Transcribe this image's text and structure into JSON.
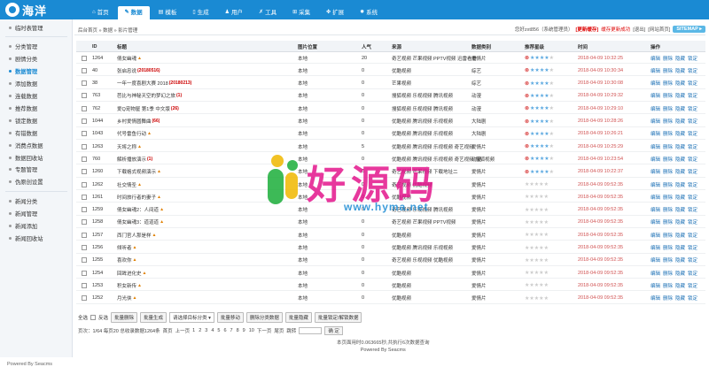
{
  "logo": {
    "text": "海洋"
  },
  "nav": [
    {
      "label": "首页",
      "icon": "home-icon",
      "glyph": "⌂",
      "active": false
    },
    {
      "label": "数据",
      "icon": "edit-icon",
      "glyph": "✎",
      "active": true
    },
    {
      "label": "模板",
      "icon": "template-icon",
      "glyph": "▤",
      "active": false
    },
    {
      "label": "生成",
      "icon": "file-icon",
      "glyph": "▯",
      "active": false
    },
    {
      "label": "用户",
      "icon": "user-icon",
      "glyph": "♟",
      "active": false
    },
    {
      "label": "工具",
      "icon": "tool-icon",
      "glyph": "✗",
      "active": false
    },
    {
      "label": "采集",
      "icon": "collect-icon",
      "glyph": "⊞",
      "active": false
    },
    {
      "label": "扩展",
      "icon": "extend-icon",
      "glyph": "✤",
      "active": false
    },
    {
      "label": "系统",
      "icon": "gear-icon",
      "glyph": "✹",
      "active": false
    }
  ],
  "sidebar": {
    "groups": [
      [
        "临时表管理"
      ],
      [
        "分类管理",
        "剧情分类",
        "数据管理",
        "添加数据",
        "连载数据",
        "推荐数据",
        "锁定数据",
        "有错数据",
        "消费点数据",
        "数据回收站",
        "专题管理",
        "伪原创设置"
      ],
      [
        "新闻分类",
        "新闻管理",
        "新闻添加",
        "新闻回收站"
      ]
    ],
    "active": "数据管理",
    "powered": "Powered By Seacms"
  },
  "crumb": "后台首页 » 数据 » 影片管理",
  "topright": {
    "user": "您好zxt856（系统管理员）",
    "update": "[更新缓存]",
    "update_ok": "缓存更新成功",
    "logout": "[退出]",
    "home": "[网站首页]",
    "sitemap": "SITEMAP ▸"
  },
  "headers": {
    "id": "ID",
    "title": "标题",
    "pos": "图片位置",
    "pop": "人气",
    "src": "来源",
    "cat": "数据类别",
    "stars": "推荐星级",
    "time": "时间",
    "op": "操作"
  },
  "ops": [
    "编辑",
    "删除",
    "隐藏",
    "锁定"
  ],
  "rows": [
    {
      "id": "1264",
      "title": "倩女幽魂",
      "badge": "",
      "hot": true,
      "pos": "本地",
      "pop": "20",
      "src": "奇艺视频 芒果视频 PPTV视频 迅雷看看",
      "cat": "爱情片",
      "stars": 4,
      "time": "2018-04-09 10:32:25"
    },
    {
      "id": "40",
      "title": "张启忠说",
      "badge": "(20180516)",
      "hot": false,
      "pos": "本地",
      "pop": "0",
      "src": "优酷视频",
      "cat": "综艺",
      "stars": 4,
      "time": "2018-04-09 10:30:34"
    },
    {
      "id": "38",
      "title": "一年一度喜剧大赛 2018",
      "badge": "(20180213)",
      "hot": false,
      "pos": "本地",
      "pop": "0",
      "src": "芒果视频",
      "cat": "综艺",
      "stars": 4,
      "time": "2018-04-09 10:30:08"
    },
    {
      "id": "763",
      "title": "芭比与神秘天空的梦幻之旅",
      "badge": "(1)",
      "hot": false,
      "pos": "本地",
      "pop": "0",
      "src": "搜狐视频 乐视视频 腾讯视频",
      "cat": "动漫",
      "stars": 4,
      "time": "2018-04-09 10:29:32"
    },
    {
      "id": "762",
      "title": "爱Q宠物屋 第1季 中文版",
      "badge": "(26)",
      "hot": false,
      "pos": "本地",
      "pop": "0",
      "src": "搜狐视频 乐视视频 腾讯视频",
      "cat": "动漫",
      "stars": 4,
      "time": "2018-04-09 10:29:10"
    },
    {
      "id": "1044",
      "title": "乡村爱情圆舞曲",
      "badge": "(66)",
      "hot": false,
      "pos": "本地",
      "pop": "0",
      "src": "优酷视频 腾讯视频 乐视视频",
      "cat": "大陆剧",
      "stars": 4,
      "time": "2018-04-09 10:28:26"
    },
    {
      "id": "1043",
      "title": "代号雷鱼行动",
      "badge": "",
      "hot": true,
      "pos": "本地",
      "pop": "0",
      "src": "优酷视频 腾讯视频 乐视视频",
      "cat": "大陆剧",
      "stars": 4,
      "time": "2018-04-09 10:26:21"
    },
    {
      "id": "1263",
      "title": "天将之称",
      "badge": "",
      "hot": true,
      "pos": "本地",
      "pop": "5",
      "src": "优酷视频 腾讯视频 乐视视频 奇艺视频",
      "cat": "爱情片",
      "stars": 4,
      "time": "2018-04-09 10:25:29"
    },
    {
      "id": "760",
      "title": "解析播放演示",
      "badge": "(1)",
      "hot": false,
      "pos": "本地",
      "pop": "0",
      "src": "优酷视频 腾讯视频 乐视视频 奇艺视频 搜狐视频",
      "cat": "动漫",
      "stars": 4,
      "time": "2018-04-09 10:23:54"
    },
    {
      "id": "1260",
      "title": "下载格式视频演示",
      "badge": "",
      "hot": true,
      "pos": "本地",
      "pop": "0",
      "src": "奇艺视频 芒果视频 下载地址二",
      "cat": "爱情片",
      "stars": 4,
      "time": "2018-04-09 10:22:37"
    },
    {
      "id": "1262",
      "title": "社交情圣",
      "badge": "",
      "hot": true,
      "pos": "本地",
      "pop": "0",
      "src": "奇艺视频 优酷视频",
      "cat": "爱情片",
      "stars": 0,
      "time": "2018-04-09 09:52:35"
    },
    {
      "id": "1261",
      "title": "时间旅行者的妻子",
      "badge": "",
      "hot": true,
      "pos": "本地",
      "pop": "0",
      "src": "优酷视频",
      "cat": "爱情片",
      "stars": 0,
      "time": "2018-04-09 09:52:35"
    },
    {
      "id": "1259",
      "title": "倩女幽魂2：人间道",
      "badge": "",
      "hot": true,
      "pos": "本地",
      "pop": "0",
      "src": "奇艺视频 乐视视频 腾讯视频",
      "cat": "爱情片",
      "stars": 0,
      "time": "2018-04-09 09:52:35"
    },
    {
      "id": "1258",
      "title": "倩女幽魂3：道道道",
      "badge": "",
      "hot": true,
      "pos": "本地",
      "pop": "0",
      "src": "奇艺视频 芒果视频 PPTV视频",
      "cat": "爱情片",
      "stars": 0,
      "time": "2018-04-09 09:52:35"
    },
    {
      "id": "1257",
      "title": "西门官人那是样",
      "badge": "",
      "hot": true,
      "pos": "本地",
      "pop": "0",
      "src": "优酷视频",
      "cat": "爱情片",
      "stars": 0,
      "time": "2018-04-09 09:52:35"
    },
    {
      "id": "1256",
      "title": "倾听者",
      "badge": "",
      "hot": true,
      "pos": "本地",
      "pop": "0",
      "src": "优酷视频 腾讯视频 乐视视频",
      "cat": "爱情片",
      "stars": 0,
      "time": "2018-04-09 09:52:35"
    },
    {
      "id": "1255",
      "title": "喜欢你",
      "badge": "",
      "hot": true,
      "pos": "本地",
      "pop": "0",
      "src": "奇艺视频 乐视视频 优酷视频",
      "cat": "爱情片",
      "stars": 0,
      "time": "2018-04-09 09:52:35"
    },
    {
      "id": "1254",
      "title": "回眸进化史",
      "badge": "",
      "hot": true,
      "pos": "本地",
      "pop": "0",
      "src": "优酷视频",
      "cat": "爱情片",
      "stars": 0,
      "time": "2018-04-09 09:52:35"
    },
    {
      "id": "1253",
      "title": "积女新传",
      "badge": "",
      "hot": true,
      "pos": "本地",
      "pop": "0",
      "src": "优酷视频",
      "cat": "爱情片",
      "stars": 0,
      "time": "2018-04-09 09:52:35"
    },
    {
      "id": "1252",
      "title": "月光侠",
      "badge": "",
      "hot": true,
      "pos": "本地",
      "pop": "0",
      "src": "优酷视频",
      "cat": "爱情片",
      "stars": 0,
      "time": "2018-04-09 09:52:35"
    }
  ],
  "batch": {
    "select_all": "全选",
    "invert": "反选",
    "buttons_a": [
      "批量删除",
      "批量生成"
    ],
    "select_placeholder": "请选择目标分类",
    "buttons_b": [
      "批量移动",
      "删除分类数据",
      "批量隐藏",
      "批量锁定/解锁数据"
    ]
  },
  "pager": {
    "info": "页次：1/64 每页20 总收录数据1264条",
    "first": "首页",
    "prev": "上一页",
    "pages": [
      "1",
      "2",
      "3",
      "4",
      "5",
      "6",
      "7",
      "8",
      "9",
      "10"
    ],
    "next": "下一页",
    "last": "尾页",
    "jump": "跳转",
    "go": "确 定"
  },
  "footer": {
    "line1": "本页面用时0.063665秒,共执行6次数据查询",
    "line2": "Powered By Seacms"
  },
  "watermark": {
    "text": "好源码",
    "url": "www.hyma.net"
  },
  "colors": {
    "brand": "#1a8ad3",
    "accent": "#e3168d",
    "danger": "#d00000"
  }
}
